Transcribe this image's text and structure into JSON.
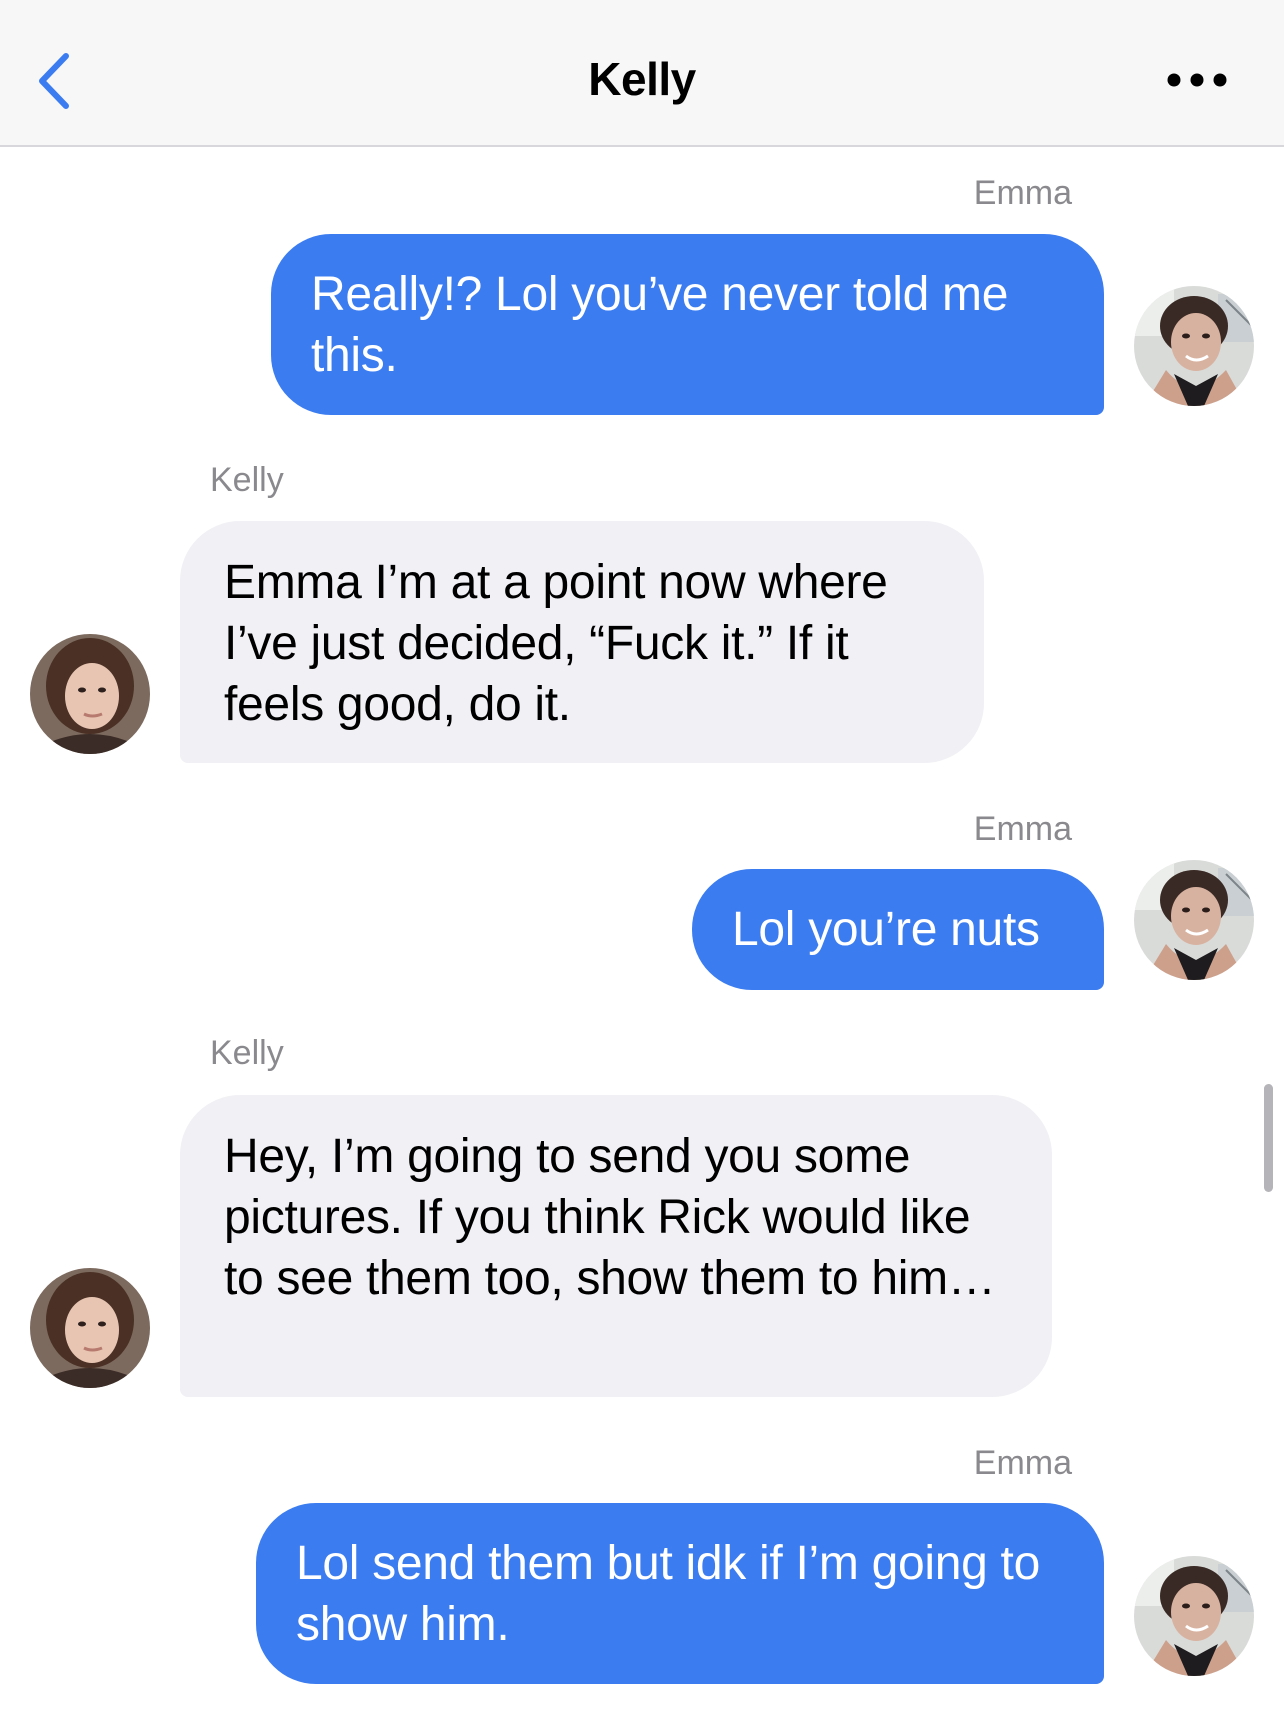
{
  "header": {
    "title": "Kelly",
    "back_icon": "chevron-left-icon",
    "more_icon": "ellipsis-icon",
    "accent_color": "#3b7cf0"
  },
  "colors": {
    "outgoing_bubble": "#3b7cf0",
    "incoming_bubble": "#f0f0f5",
    "sender_label": "#8a8a8e"
  },
  "messages": [
    {
      "sender": "Emma",
      "direction": "outgoing",
      "text": "Really!? Lol you’ve never told me this."
    },
    {
      "sender": "Kelly",
      "direction": "incoming",
      "text": "Emma I’m at a point now where I’ve just decided, “Fuck it.” If it feels good, do it."
    },
    {
      "sender": "Emma",
      "direction": "outgoing",
      "text": "Lol you’re nuts"
    },
    {
      "sender": "Kelly",
      "direction": "incoming",
      "text": "Hey, I’m going to send you some pictures. If you think Rick would like to see them too, show them to him…"
    },
    {
      "sender": "Emma",
      "direction": "outgoing",
      "text": "Lol send them but idk if I’m going to show him."
    }
  ]
}
